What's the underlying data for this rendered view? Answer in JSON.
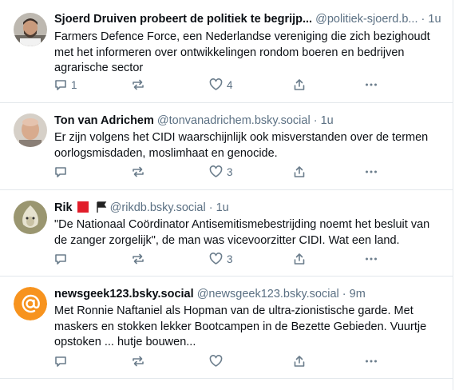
{
  "posts": [
    {
      "name": "Sjoerd Druiven probeert de politiek te begrijp...",
      "handle": "@politiek-sjoerd.b...",
      "sep": "·",
      "time": "1u",
      "text": "Farmers Defence Force, een Nederlandse vereniging die zich bezighoudt met het informeren over ontwikkelingen rondom boeren en bedrijven agrarische sector",
      "reply_count": "1",
      "like_count": "4",
      "avatar_icon": "person-photo"
    },
    {
      "name": "Ton van Adrichem",
      "handle": "@tonvanadrichem.bsky.social",
      "sep": "·",
      "time": "1u",
      "text": "Er zijn volgens het CIDI waarschijnlijk ook misverstanden over de termen oorlogsmisdaden, moslimhaat en genocide.",
      "reply_count": "",
      "like_count": "3",
      "avatar_icon": "person-photo"
    },
    {
      "name": "Rik",
      "handle": "@rikdb.bsky.social",
      "sep": "·",
      "time": "1u",
      "text": "\"De Nationaal Coördinator Antisemitismebestrijding noemt het besluit van de zanger zorgelijk\", de man was vicevoorzitter CIDI. Wat een land.",
      "reply_count": "",
      "like_count": "3",
      "avatar_icon": "onion-photo",
      "flag_colors": [
        "#e11d2a",
        "#222222"
      ]
    },
    {
      "name": "newsgeek123.bsky.social",
      "handle": "@newsgeek123.bsky.social",
      "sep": "·",
      "time": "9m",
      "text": "Met Ronnie Naftaniel als Hopman van de ultra-zionistische garde. Met maskers en stokken lekker Bootcampen in de Bezette Gebieden. Vuurtje opstoken ... hutje bouwen...",
      "reply_count": "",
      "like_count": "",
      "avatar_icon": "at-sign-icon",
      "avatar_color": "#f7931e"
    }
  ]
}
